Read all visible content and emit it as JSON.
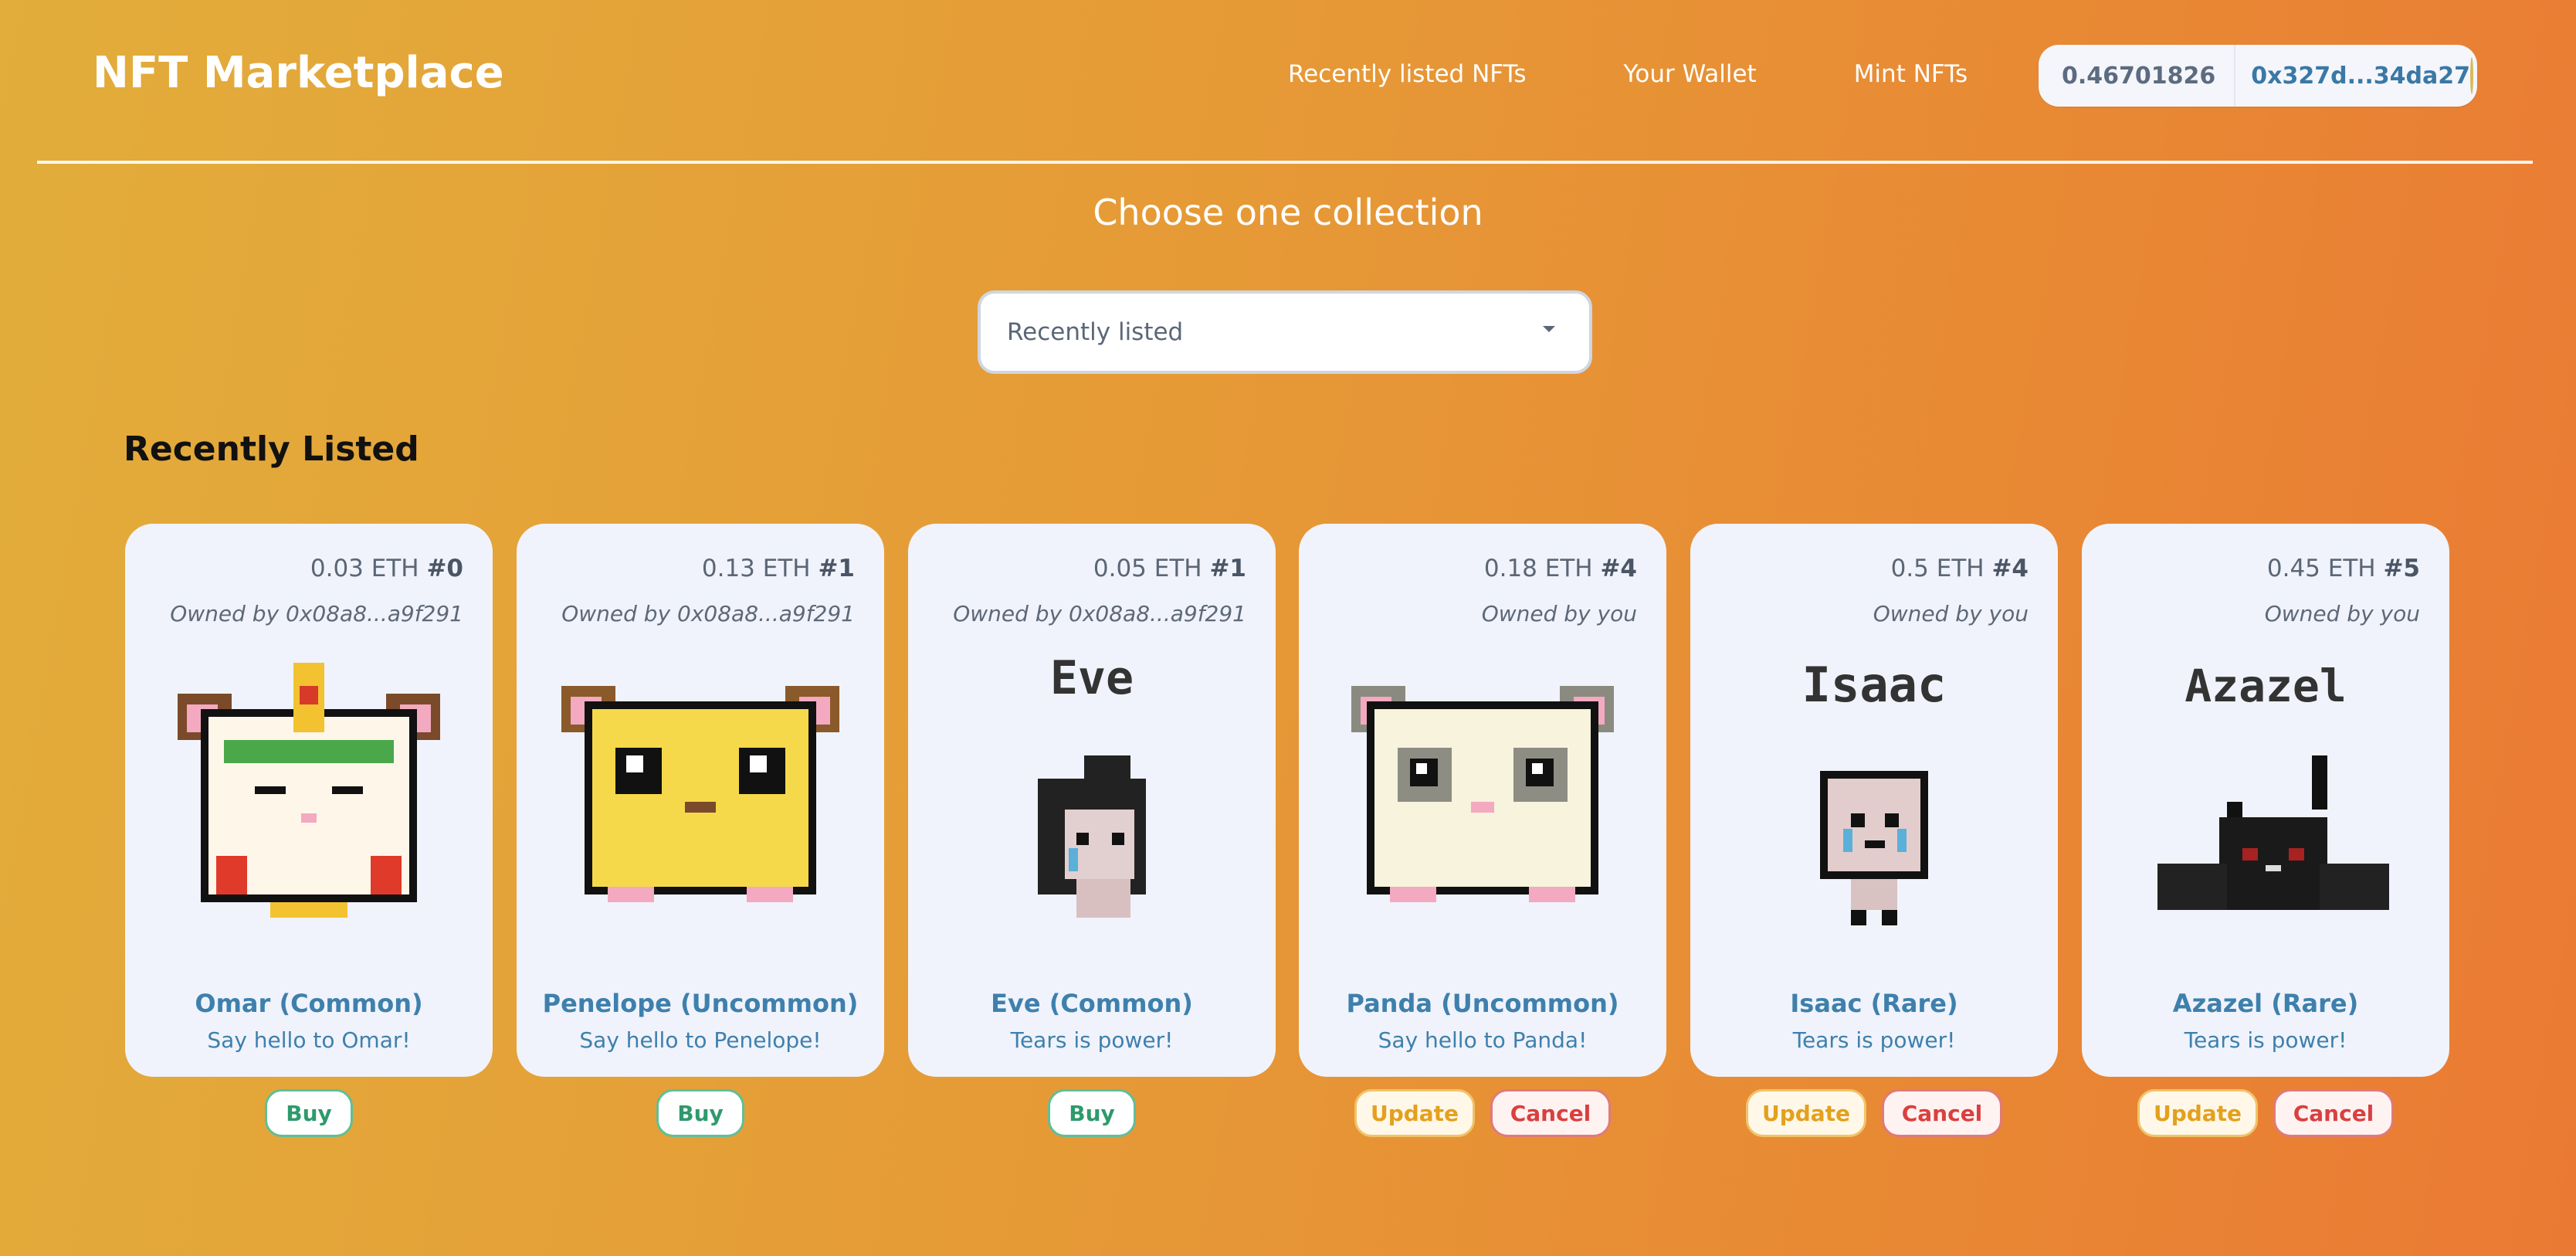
{
  "header": {
    "brand": "NFT Marketplace",
    "nav": [
      "Recently listed NFTs",
      "Your Wallet",
      "Mint NFTs"
    ],
    "wallet": {
      "balance": "0.46701826",
      "address": "0x327d...34da27"
    }
  },
  "collection": {
    "heading": "Choose one collection",
    "selected": "Recently listed"
  },
  "section_title": "Recently Listed",
  "cards": [
    {
      "price": "0.03 ETH",
      "token": "#0",
      "owner": "Owned by 0x08a8...a9f291",
      "title": "Omar (Common)",
      "description": "Say hello to Omar!",
      "actions": [
        "Buy"
      ],
      "art": "hamster-omar-icon"
    },
    {
      "price": "0.13 ETH",
      "token": "#1",
      "owner": "Owned by 0x08a8...a9f291",
      "title": "Penelope (Uncommon)",
      "description": "Say hello to Penelope!",
      "actions": [
        "Buy"
      ],
      "art": "hamster-penelope-icon"
    },
    {
      "price": "0.05 ETH",
      "token": "#1",
      "owner": "Owned by 0x08a8...a9f291",
      "title": "Eve (Common)",
      "description": "Tears is power!",
      "art_label": "Eve",
      "actions": [
        "Buy"
      ],
      "art": "character-eve-icon"
    },
    {
      "price": "0.18 ETH",
      "token": "#4",
      "owner": "Owned by you",
      "title": "Panda (Uncommon)",
      "description": "Say hello to Panda!",
      "actions": [
        "Update",
        "Cancel"
      ],
      "art": "hamster-panda-icon"
    },
    {
      "price": "0.5 ETH",
      "token": "#4",
      "owner": "Owned by you",
      "title": "Isaac (Rare)",
      "description": "Tears is power!",
      "art_label": "Isaac",
      "actions": [
        "Update",
        "Cancel"
      ],
      "art": "character-isaac-icon"
    },
    {
      "price": "0.45 ETH",
      "token": "#5",
      "owner": "Owned by you",
      "title": "Azazel (Rare)",
      "description": "Tears is power!",
      "art_label": "Azazel",
      "actions": [
        "Update",
        "Cancel"
      ],
      "art": "character-azazel-icon"
    }
  ]
}
